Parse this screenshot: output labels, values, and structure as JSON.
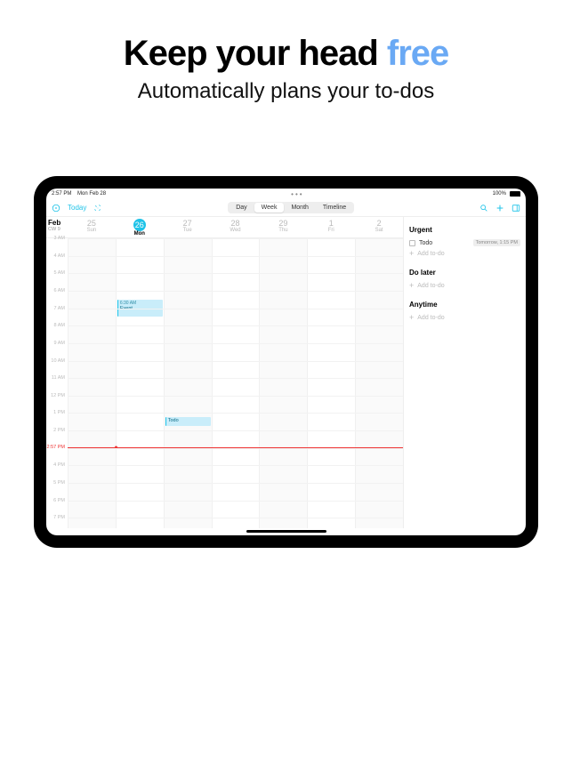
{
  "marketing": {
    "headline_a": "Keep your head ",
    "headline_b": "free",
    "subtitle": "Automatically plans your to-dos"
  },
  "statusbar": {
    "time": "2:57 PM",
    "date": "Mon Feb 28",
    "battery": "100%"
  },
  "toolbar": {
    "today": "Today",
    "views": [
      "Day",
      "Week",
      "Month",
      "Timeline"
    ],
    "selected_view": "Week"
  },
  "calendar": {
    "month": "Feb",
    "cw": "CW 9",
    "days": [
      {
        "num": "25",
        "dow": "Sun",
        "weekend": true
      },
      {
        "num": "26",
        "dow": "Mon",
        "today": true
      },
      {
        "num": "27",
        "dow": "Tue"
      },
      {
        "num": "28",
        "dow": "Wed"
      },
      {
        "num": "29",
        "dow": "Thu"
      },
      {
        "num": "1",
        "dow": "Fri"
      },
      {
        "num": "2",
        "dow": "Sat",
        "weekend": true
      }
    ],
    "hours": [
      "3 AM",
      "4 AM",
      "5 AM",
      "6 AM",
      "7 AM",
      "8 AM",
      "9 AM",
      "10 AM",
      "11 AM",
      "12 PM",
      "1 PM",
      "2 PM",
      "2:57 PM",
      "4 PM",
      "5 PM",
      "6 PM",
      "7 PM"
    ],
    "hour_start": 3,
    "hour_end": 20,
    "now_label": "2:57 PM",
    "now_hour": 14.95,
    "events": [
      {
        "day": 1,
        "start": 6.5,
        "end": 7.5,
        "time": "6:30 AM",
        "title": "Event"
      },
      {
        "day": 2,
        "start": 13.25,
        "end": 13.75,
        "time": "",
        "title": "Todo"
      }
    ]
  },
  "sidebar": {
    "sections": [
      {
        "title": "Urgent",
        "items": [
          {
            "label": "Todo",
            "due": "Tomorrow, 1:15 PM"
          }
        ]
      },
      {
        "title": "Do later",
        "items": []
      },
      {
        "title": "Anytime",
        "items": []
      }
    ],
    "add_label": "Add to-do"
  }
}
